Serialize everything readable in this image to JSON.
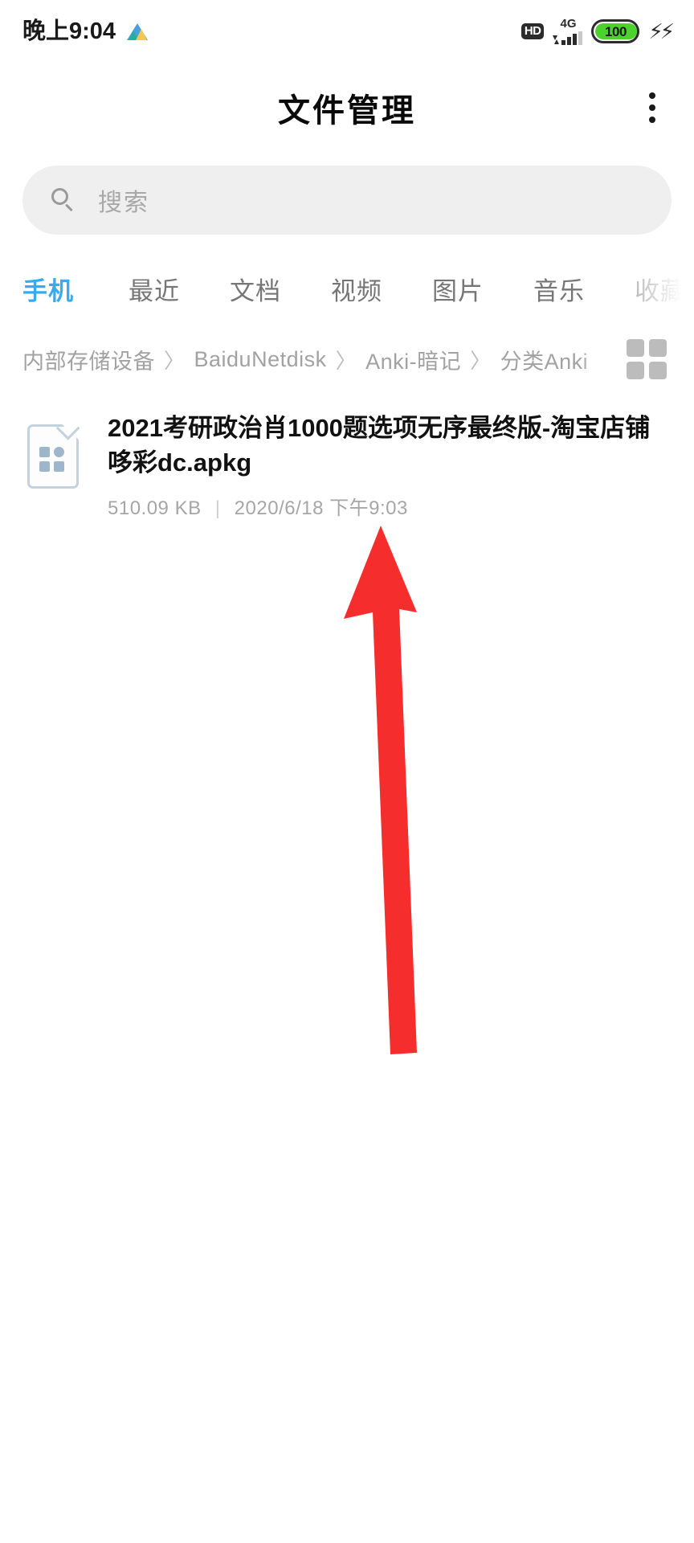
{
  "status_bar": {
    "time": "晚上9:04",
    "notification_icon": "app-triangle-icon",
    "hd_label": "HD",
    "network_label": "4G",
    "battery_level": "100",
    "battery_color": "#4bd22c",
    "charging_icon": "⚡⚡"
  },
  "app_bar": {
    "title": "文件管理",
    "overflow_icon": "more-vertical-icon"
  },
  "search": {
    "placeholder": "搜索",
    "icon": "search-icon"
  },
  "tabs": {
    "active_index": 0,
    "active_color": "#3ba9ef",
    "items": [
      {
        "label": "手机"
      },
      {
        "label": "最近"
      },
      {
        "label": "文档"
      },
      {
        "label": "视频"
      },
      {
        "label": "图片"
      },
      {
        "label": "音乐"
      },
      {
        "label": "收藏"
      }
    ]
  },
  "breadcrumb": {
    "separator": "〉",
    "items": [
      {
        "label": "内部存储设备"
      },
      {
        "label": "BaiduNetdisk"
      },
      {
        "label": "Anki-暗记"
      },
      {
        "label": "分类Anki"
      }
    ]
  },
  "view_toggle": {
    "icon": "grid-view-icon"
  },
  "file_list": {
    "items": [
      {
        "icon": "apkg-file-icon",
        "name": "2021考研政治肖1000题选项无序最终版-淘宝店铺哆彩dc.apkg",
        "size": "510.09 KB",
        "divider": "|",
        "date": "2020/6/18 下午9:03"
      }
    ]
  },
  "annotation": {
    "type": "arrow",
    "color": "#f62d2d",
    "direction": "up",
    "points_to": "file-list-item"
  }
}
